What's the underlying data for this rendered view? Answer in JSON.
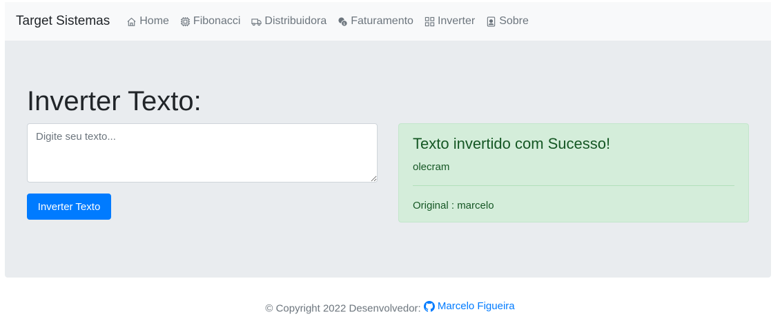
{
  "nav": {
    "brand": "Target Sistemas",
    "items": [
      {
        "label": "Home",
        "icon": "house-icon"
      },
      {
        "label": "Fibonacci",
        "icon": "cpu-icon"
      },
      {
        "label": "Distribuidora",
        "icon": "truck-icon"
      },
      {
        "label": "Faturamento",
        "icon": "coins-icon"
      },
      {
        "label": "Inverter",
        "icon": "grid-icon"
      },
      {
        "label": "Sobre",
        "icon": "person-badge-icon"
      }
    ]
  },
  "main": {
    "title": "Inverter Texto:",
    "input_placeholder": "Digite seu texto...",
    "input_value": "",
    "button_label": "Inverter Texto"
  },
  "result": {
    "heading": "Texto invertido com Sucesso!",
    "inverted": "olecram",
    "original_label": "Original : marcelo"
  },
  "footer": {
    "text": "© Copyright 2022 Desenvolvedor:",
    "link_label": "Marcelo Figueira",
    "link_icon": "github-icon"
  },
  "colors": {
    "primary": "#007bff",
    "success_bg": "#d4edda",
    "success_text": "#155724",
    "jumbotron_bg": "#e9ecef",
    "navbar_bg": "#f8f9fa"
  }
}
